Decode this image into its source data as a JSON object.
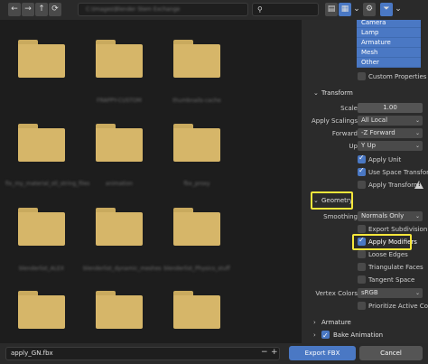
{
  "topbar": {
    "back_icon": "←",
    "forward_icon": "→",
    "parent_icon": "↑",
    "refresh_icon": "⟳",
    "path": "C:\\Images\\Blender Stem Exchange",
    "search_icon": "⚲",
    "display_icons": [
      "▤",
      "▦",
      "⌄",
      "⚙"
    ],
    "filter_icon": "⏷",
    "filter_chevron": "⌄",
    "filter_color": "#4a78c4"
  },
  "browser": {
    "folders": [
      {
        "name": ""
      },
      {
        "name": "FRAPPY-CUSTOM"
      },
      {
        "name": "thumbnails-cache"
      },
      {
        "name": "fix_my_material_stl_string_files"
      },
      {
        "name": "animation"
      },
      {
        "name": "fbx_proxy"
      },
      {
        "name": "blenderlist_ALEX"
      },
      {
        "name": "blenderlist_dynamic_meshes"
      },
      {
        "name": "blenderlist_Physics_stuff"
      },
      {
        "name": ""
      },
      {
        "name": ""
      },
      {
        "name": ""
      }
    ],
    "folder_color": "#d6b669"
  },
  "panel": {
    "object_types": [
      "Camera",
      "Lamp",
      "Armature",
      "Mesh",
      "Other"
    ],
    "custom_properties": {
      "label": "Custom Properties",
      "checked": false
    },
    "transform": {
      "header": "Transform",
      "scale": {
        "label": "Scale",
        "value": "1.00"
      },
      "apply_scalings": {
        "label": "Apply Scalings",
        "value": "All Local"
      },
      "forward": {
        "label": "Forward",
        "value": "-Z Forward"
      },
      "up": {
        "label": "Up",
        "value": "Y Up"
      },
      "apply_unit": {
        "label": "Apply Unit",
        "checked": true
      },
      "use_space_transform": {
        "label": "Use Space Transform",
        "checked": true
      },
      "apply_transform": {
        "label": "Apply Transform",
        "checked": false
      }
    },
    "geometry": {
      "header": "Geometry",
      "smoothing": {
        "label": "Smoothing",
        "value": "Normals Only"
      },
      "export_subdivision": {
        "label": "Export Subdivision ...",
        "checked": false
      },
      "apply_modifiers": {
        "label": "Apply Modifiers",
        "checked": true
      },
      "loose_edges": {
        "label": "Loose Edges",
        "checked": false
      },
      "triangulate_faces": {
        "label": "Triangulate Faces",
        "checked": false
      },
      "tangent_space": {
        "label": "Tangent Space",
        "checked": false
      },
      "vertex_colors": {
        "label": "Vertex Colors",
        "value": "sRGB"
      },
      "prioritize_active_color": {
        "label": "Prioritize Active Color",
        "checked": false
      }
    },
    "armature": {
      "header": "Armature"
    },
    "bake_animation": {
      "header": "Bake Animation",
      "checked": true
    },
    "highlight_color": "#f5e63b"
  },
  "bottombar": {
    "filename": "apply_GN.fbx",
    "minus": "−",
    "plus": "+",
    "export_label": "Export FBX",
    "cancel_label": "Cancel",
    "export_color": "#4a78c4"
  }
}
